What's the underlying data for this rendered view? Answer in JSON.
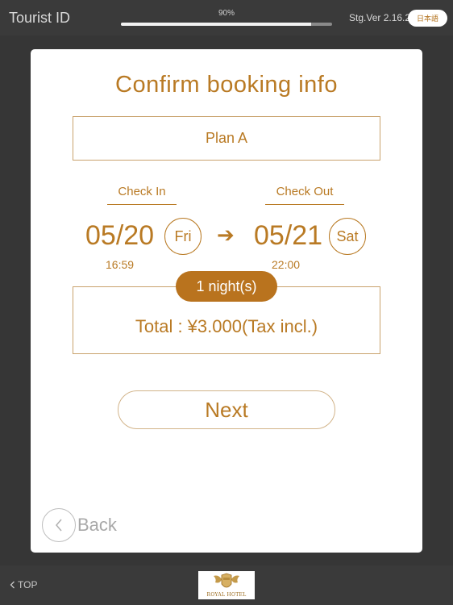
{
  "header": {
    "app_title": "Tourist ID",
    "progress_label": "90%",
    "progress_value": 0.9,
    "version": "Stg.Ver 2.16.2",
    "language_button": "日本語"
  },
  "booking": {
    "title": "Confirm booking info",
    "plan": "Plan A",
    "check_in": {
      "label": "Check In",
      "date": "05/20",
      "day": "Fri",
      "time": "16:59"
    },
    "arrow": "➔",
    "check_out": {
      "label": "Check Out",
      "date": "05/21",
      "day": "Sat",
      "time": "22:00"
    },
    "nights": "1 night(s)",
    "total": "Total : ¥3.000(Tax incl.)",
    "next_button": "Next",
    "back_button": "Back"
  },
  "footer": {
    "top_link": "TOP",
    "logo_text": "ROYAL HOTEL"
  },
  "colors": {
    "accent": "#b97a24",
    "background": "#363636",
    "card": "#ffffff"
  }
}
